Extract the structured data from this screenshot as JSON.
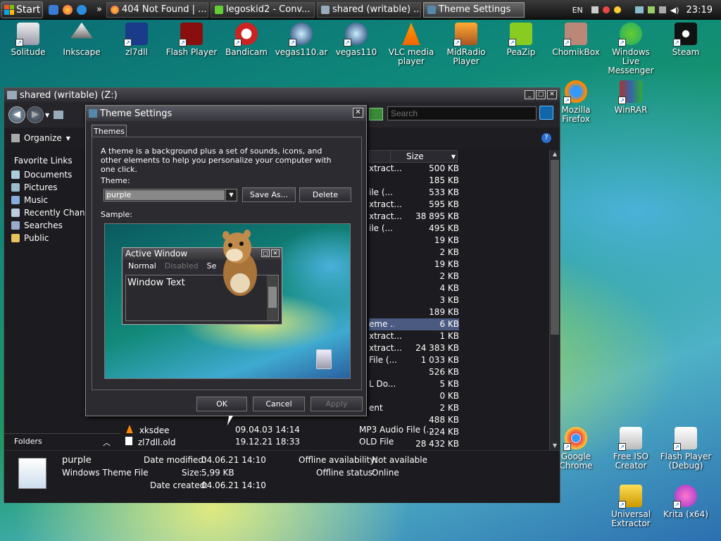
{
  "taskbar": {
    "start_label": "Start",
    "buttons": [
      {
        "label": "404 Not Found | ..."
      },
      {
        "label": "legoskid2 - Conv..."
      },
      {
        "label": "shared (writable) ..."
      },
      {
        "label": "Theme Settings"
      }
    ],
    "lang": "EN",
    "clock": "23:19"
  },
  "desktop_icons": [
    {
      "label": "Solitude"
    },
    {
      "label": "Inkscape"
    },
    {
      "label": "zl7dll"
    },
    {
      "label": "Flash Player"
    },
    {
      "label": "Bandicam"
    },
    {
      "label": "vegas110.ar"
    },
    {
      "label": "vegas110"
    },
    {
      "label": "VLC media player"
    },
    {
      "label": "MidRadio Player"
    },
    {
      "label": "PeaZip"
    },
    {
      "label": "ChomikBox"
    },
    {
      "label": "Windows Live Messenger"
    },
    {
      "label": "Steam"
    },
    {
      "label": "Mozilla Firefox"
    },
    {
      "label": "WinRAR"
    },
    {
      "label": "Google Chrome"
    },
    {
      "label": "Free ISO Creator"
    },
    {
      "label": "Flash Player (Debug)"
    },
    {
      "label": "Universal Extractor"
    },
    {
      "label": "Krita (x64)"
    }
  ],
  "explorer": {
    "title": "shared (writable) (Z:)",
    "search_placeholder": "Search",
    "organize_label": "Organize",
    "favorite_links_header": "Favorite Links",
    "nav_items": [
      {
        "label": "Documents"
      },
      {
        "label": "Pictures"
      },
      {
        "label": "Music"
      },
      {
        "label": "Recently Changed"
      },
      {
        "label": "Searches"
      },
      {
        "label": "Public"
      }
    ],
    "folders_label": "Folders",
    "size_header": "Size",
    "sizes": [
      "500 KB",
      "185 KB",
      "533 KB",
      "595 KB",
      "38 895 KB",
      "495 KB",
      "19 KB",
      "2 KB",
      "19 KB",
      "2 KB",
      "4 KB",
      "3 KB",
      "189 KB",
      "6 KB",
      "1 KB",
      "24 383 KB",
      "1 033 KB",
      "526 KB",
      "5 KB",
      "0 KB",
      "2 KB",
      "488 KB",
      "224 KB",
      "28 432 KB"
    ],
    "types": [
      "xtract...",
      "",
      "ile (...",
      "xtract...",
      "xtract...",
      "ile (...",
      "",
      "",
      "",
      "",
      "",
      "",
      "",
      "eme ...",
      "xtract...",
      "xtract...",
      "File (...",
      "",
      "L Do...",
      "",
      "ent",
      "",
      ""
    ],
    "bottom_rows": [
      {
        "name": "xksdee",
        "date": "09.04.03 14:14",
        "type": "MP3 Audio File (..."
      },
      {
        "name": "zl7dll.old",
        "date": "19.12.21 18:33",
        "type": "OLD File"
      }
    ],
    "details": {
      "name": "purple",
      "type": "Windows Theme File",
      "date_modified_label": "Date modified:",
      "date_modified": "04.06.21 14:10",
      "size_label": "Size:",
      "size": "5,99 KB",
      "date_created_label": "Date created:",
      "date_created": "04.06.21 14:10",
      "offline_avail_label": "Offline availability:",
      "offline_avail": "Not available",
      "offline_status_label": "Offline status:",
      "offline_status": "Online"
    }
  },
  "dialog": {
    "title": "Theme Settings",
    "tab_label": "Themes",
    "description": "A theme is a background plus a set of sounds, icons, and other elements to help you personalize your computer with one click.",
    "theme_label": "Theme:",
    "theme_value": "purple",
    "save_as_label": "Save As...",
    "delete_label": "Delete",
    "sample_label": "Sample:",
    "sample": {
      "active_window": "Active Window",
      "menu_normal": "Normal",
      "menu_disabled": "Disabled",
      "menu_selected": "Se",
      "window_text": "Window Text"
    },
    "ok_label": "OK",
    "cancel_label": "Cancel",
    "apply_label": "Apply"
  }
}
